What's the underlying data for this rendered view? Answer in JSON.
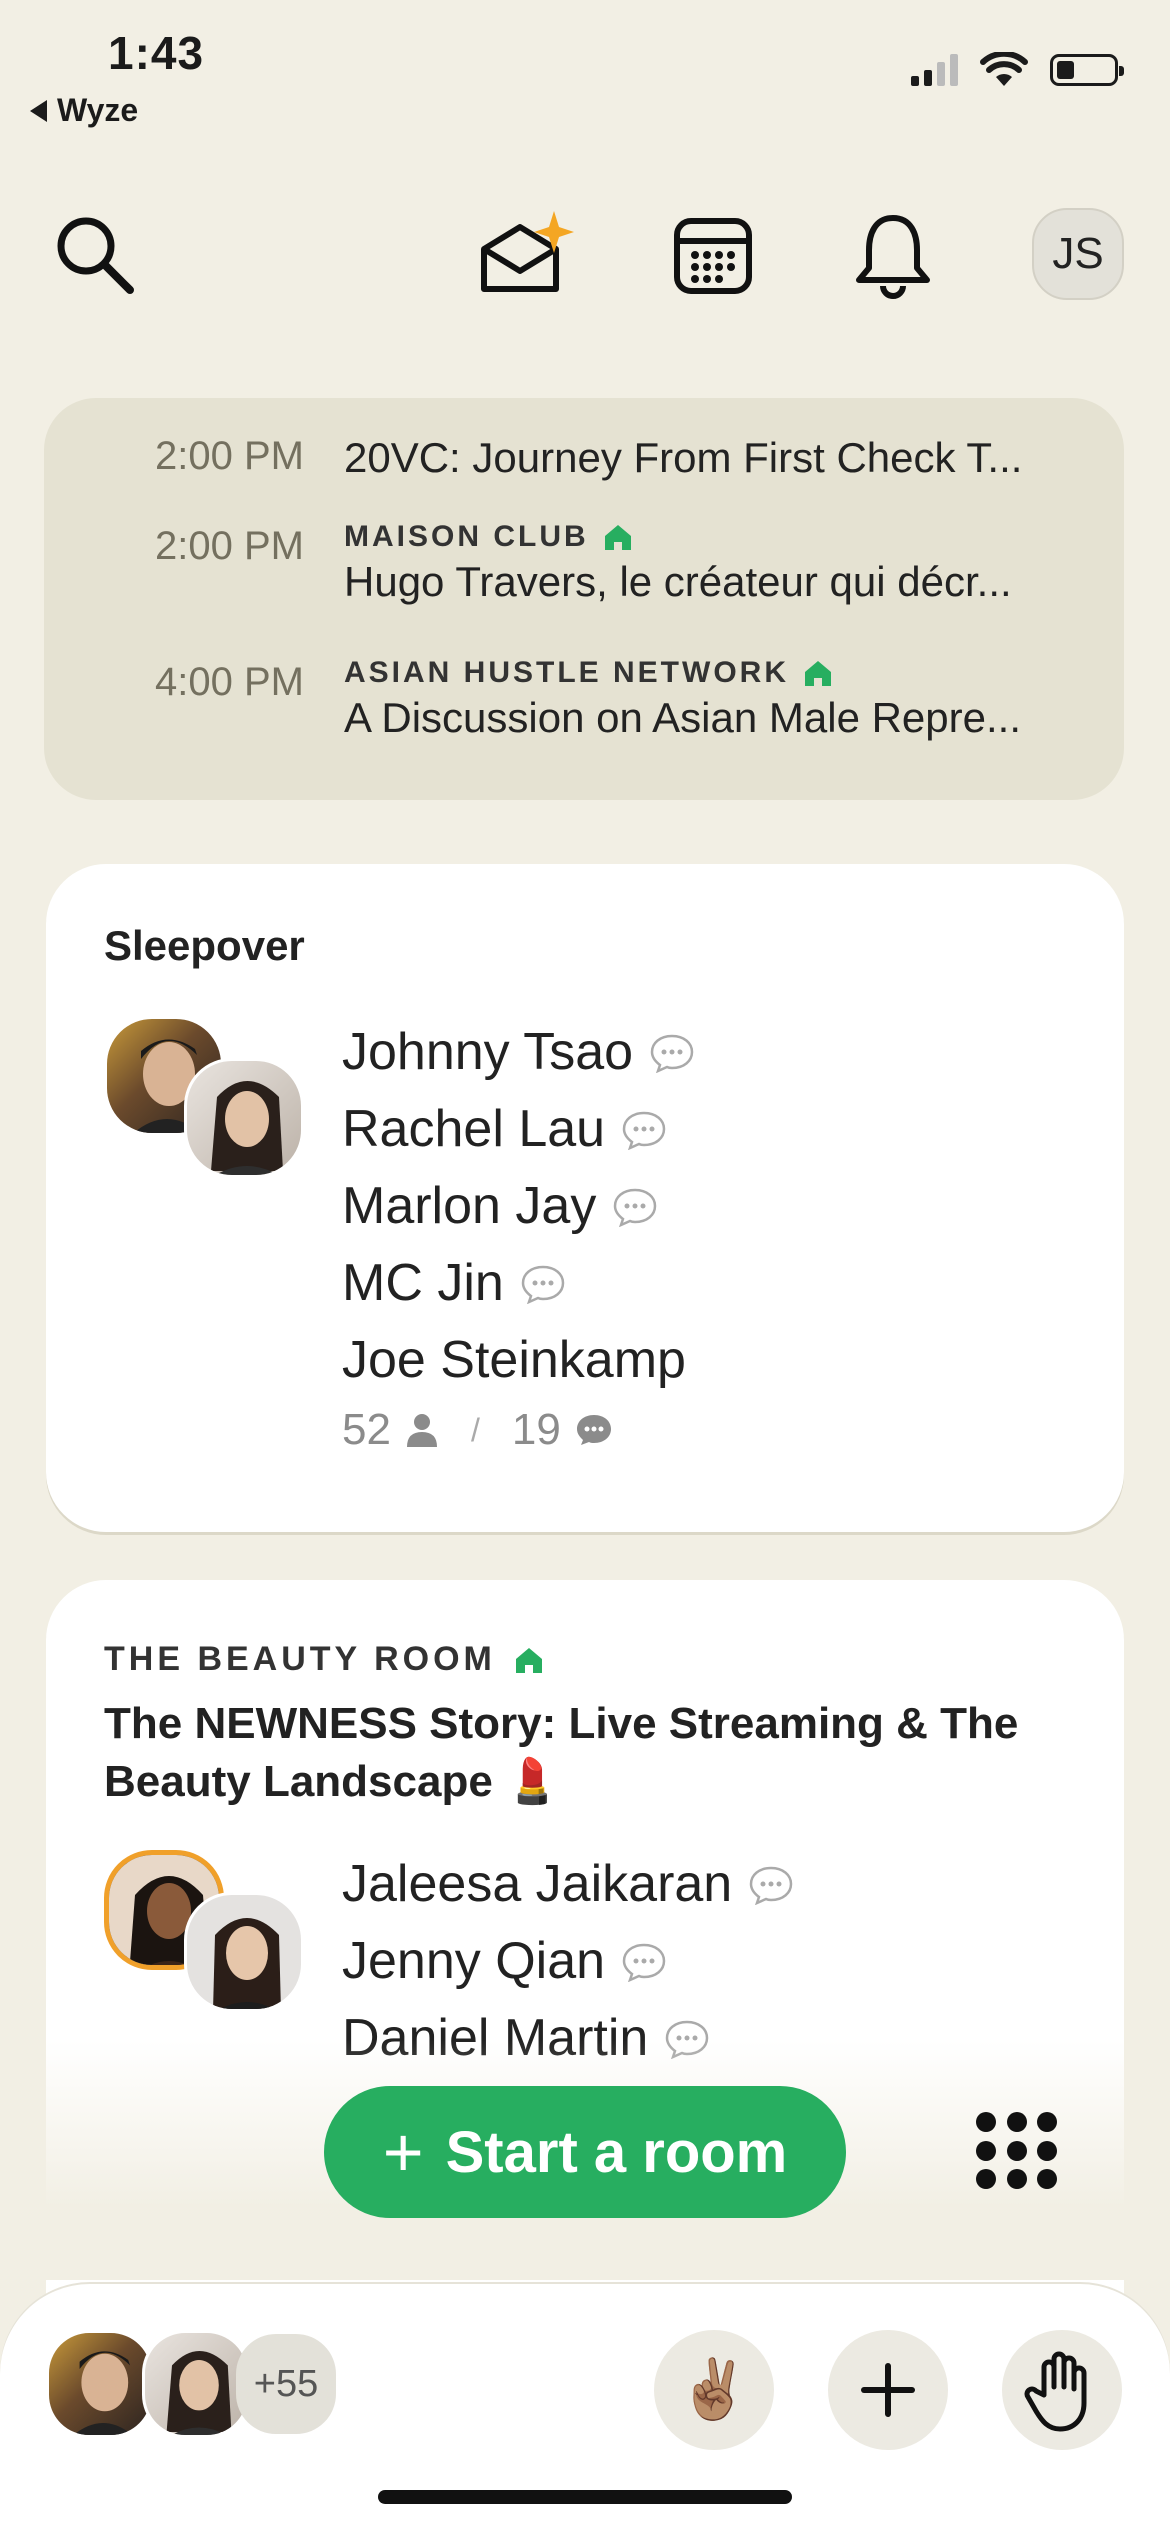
{
  "status_bar": {
    "time": "1:43",
    "back_app": "Wyze"
  },
  "top_nav": {
    "profile_initials": "JS"
  },
  "upcoming": [
    {
      "time": "2:00 PM",
      "club": "",
      "title": "20VC: Journey From First Check T..."
    },
    {
      "time": "2:00 PM",
      "club": "MAISON CLUB",
      "title": "Hugo Travers, le créateur qui décr..."
    },
    {
      "time": "4:00 PM",
      "club": "ASIAN HUSTLE NETWORK",
      "title": "A Discussion on Asian Male Repre..."
    }
  ],
  "room1": {
    "label": "Sleepover",
    "speakers": [
      "Johnny Tsao",
      "Rachel Lau",
      "Marlon Jay",
      "MC Jin"
    ],
    "other": "Joe Steinkamp",
    "listeners": "52",
    "separator": "/",
    "speakers_count": "19"
  },
  "room2": {
    "club": "THE BEAUTY ROOM",
    "title": "The NEWNESS Story: Live Streaming & The Beauty Landscape 💄",
    "speakers": [
      "Jaleesa Jaikaran",
      "Jenny Qian",
      "Daniel Martin"
    ]
  },
  "actions": {
    "start_room_label": "Start a room",
    "start_room_plus": "+"
  },
  "bottom_bar": {
    "online_count": "+55",
    "peace_emoji": "✌🏽"
  },
  "colors": {
    "accent": "#27ae60",
    "background": "#f2efe4",
    "upcoming_bg": "#e5e2d2",
    "card": "#ffffff"
  }
}
